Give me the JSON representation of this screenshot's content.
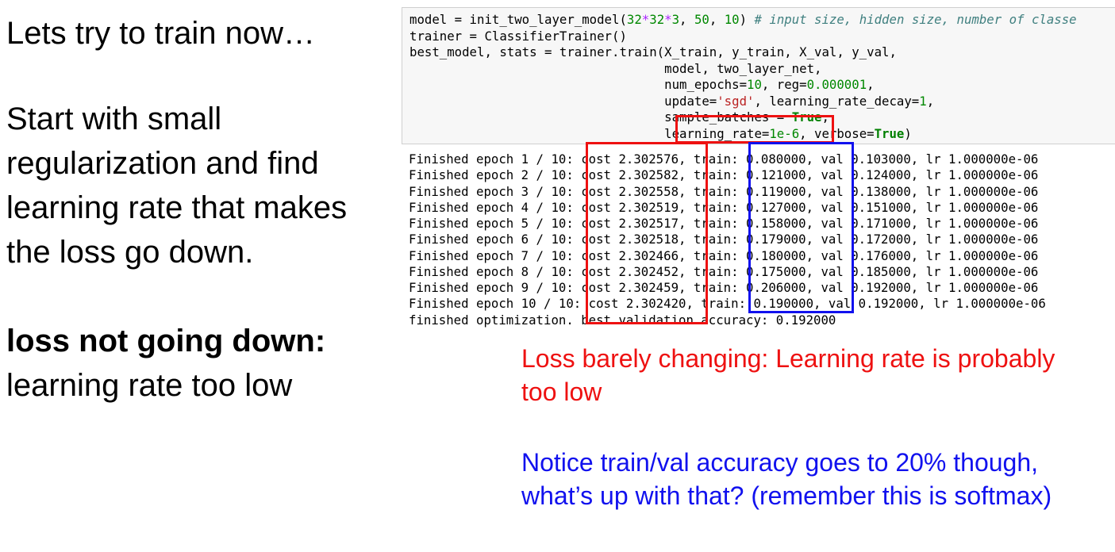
{
  "left_panel": {
    "heading": "Lets try to train now…",
    "paragraph": "Start with small regularization and find learning rate that makes the loss go down.",
    "conclusion_bold": "loss not going down:",
    "conclusion_text": "learning rate too low"
  },
  "code": {
    "lines": [
      {
        "segments": [
          {
            "text": "model = init_two_layer_model(",
            "cls": ""
          },
          {
            "text": "32",
            "cls": "kw-num"
          },
          {
            "text": "*",
            "cls": "kw-op"
          },
          {
            "text": "32",
            "cls": "kw-num"
          },
          {
            "text": "*",
            "cls": "kw-op"
          },
          {
            "text": "3",
            "cls": "kw-num"
          },
          {
            "text": ", ",
            "cls": ""
          },
          {
            "text": "50",
            "cls": "kw-num"
          },
          {
            "text": ", ",
            "cls": ""
          },
          {
            "text": "10",
            "cls": "kw-num"
          },
          {
            "text": ") ",
            "cls": ""
          },
          {
            "text": "# input size, hidden size, number of classe",
            "cls": "kw-comment"
          }
        ]
      },
      {
        "segments": [
          {
            "text": "trainer = ClassifierTrainer()",
            "cls": ""
          }
        ]
      },
      {
        "segments": [
          {
            "text": "best_model, stats = trainer.train(X_train, y_train, X_val, y_val,",
            "cls": ""
          }
        ]
      },
      {
        "segments": [
          {
            "text": "                                  model, two_layer_net,",
            "cls": ""
          }
        ]
      },
      {
        "segments": [
          {
            "text": "                                  num_epochs=",
            "cls": ""
          },
          {
            "text": "10",
            "cls": "kw-num"
          },
          {
            "text": ", reg=",
            "cls": ""
          },
          {
            "text": "0.000001",
            "cls": "kw-num"
          },
          {
            "text": ",",
            "cls": ""
          }
        ]
      },
      {
        "segments": [
          {
            "text": "                                  update=",
            "cls": ""
          },
          {
            "text": "'sgd'",
            "cls": "kw-str"
          },
          {
            "text": ", learning_rate_decay=",
            "cls": ""
          },
          {
            "text": "1",
            "cls": "kw-num"
          },
          {
            "text": ",",
            "cls": ""
          }
        ]
      },
      {
        "segments": [
          {
            "text": "                                  sample_batches = ",
            "cls": ""
          },
          {
            "text": "True",
            "cls": "kw-bool"
          },
          {
            "text": ",",
            "cls": ""
          }
        ]
      },
      {
        "segments": [
          {
            "text": "                                  learning_rate=",
            "cls": ""
          },
          {
            "text": "1e-6",
            "cls": "kw-num"
          },
          {
            "text": ", verbose=",
            "cls": ""
          },
          {
            "text": "True",
            "cls": "kw-bool"
          },
          {
            "text": ")",
            "cls": ""
          }
        ]
      }
    ]
  },
  "output": {
    "lines": [
      "Finished epoch 1 / 10: cost 2.302576, train: 0.080000, val 0.103000, lr 1.000000e-06",
      "Finished epoch 2 / 10: cost 2.302582, train: 0.121000, val 0.124000, lr 1.000000e-06",
      "Finished epoch 3 / 10: cost 2.302558, train: 0.119000, val 0.138000, lr 1.000000e-06",
      "Finished epoch 4 / 10: cost 2.302519, train: 0.127000, val 0.151000, lr 1.000000e-06",
      "Finished epoch 5 / 10: cost 2.302517, train: 0.158000, val 0.171000, lr 1.000000e-06",
      "Finished epoch 6 / 10: cost 2.302518, train: 0.179000, val 0.172000, lr 1.000000e-06",
      "Finished epoch 7 / 10: cost 2.302466, train: 0.180000, val 0.176000, lr 1.000000e-06",
      "Finished epoch 8 / 10: cost 2.302452, train: 0.175000, val 0.185000, lr 1.000000e-06",
      "Finished epoch 9 / 10: cost 2.302459, train: 0.206000, val 0.192000, lr 1.000000e-06",
      "Finished epoch 10 / 10: cost 2.302420, train: 0.190000, val 0.192000, lr 1.000000e-06",
      "finished optimization. best validation accuracy: 0.192000"
    ]
  },
  "notes": {
    "red": "Loss barely changing: Learning rate is probably too low",
    "blue": "Notice train/val accuracy goes to 20% though, what’s up with that? (remember this is softmax)"
  },
  "colors": {
    "red_annotation": "#ee1111",
    "blue_annotation": "#1111ee"
  }
}
